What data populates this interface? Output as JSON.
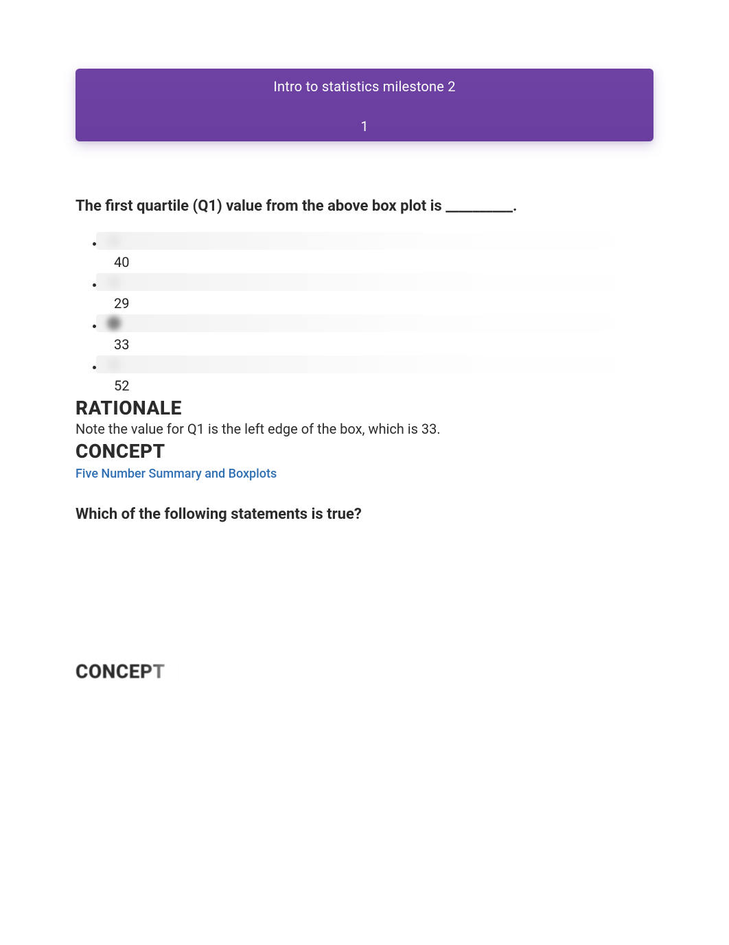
{
  "header": {
    "title": "Intro to statistics milestone 2",
    "number": "1"
  },
  "question1": {
    "prompt": "The first quartile (Q1) value from the above box plot is __________.",
    "options": [
      "40",
      "29",
      "33",
      "52"
    ],
    "rationale_heading": "RATIONALE",
    "rationale_text": "Note the value for Q1 is the left edge of the box, which is 33.",
    "concept_heading": "CONCEPT",
    "concept_link": "Five Number Summary and Boxplots"
  },
  "question2": {
    "prompt": "Which of the following statements is true?",
    "concept_heading": "CONCEPT"
  }
}
